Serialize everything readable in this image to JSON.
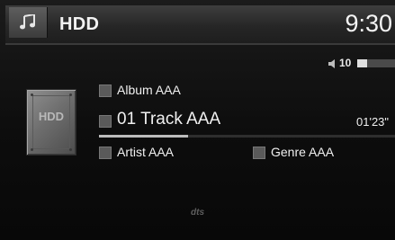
{
  "header": {
    "source_title": "HDD",
    "clock": "9:30",
    "music_icon": "music-note-icon"
  },
  "volume": {
    "level": "10",
    "level_fraction": 0.25,
    "icon": "speaker-icon"
  },
  "device": {
    "label": "HDD",
    "icon": "hard-drive-icon"
  },
  "now_playing": {
    "album": "Album AAA",
    "track": "01 Track AAA",
    "elapsed": "01'23\"",
    "artist": "Artist AAA",
    "genre": "Genre AAA",
    "progress_fraction": 0.3
  },
  "branding": {
    "logo_text": "dts"
  }
}
